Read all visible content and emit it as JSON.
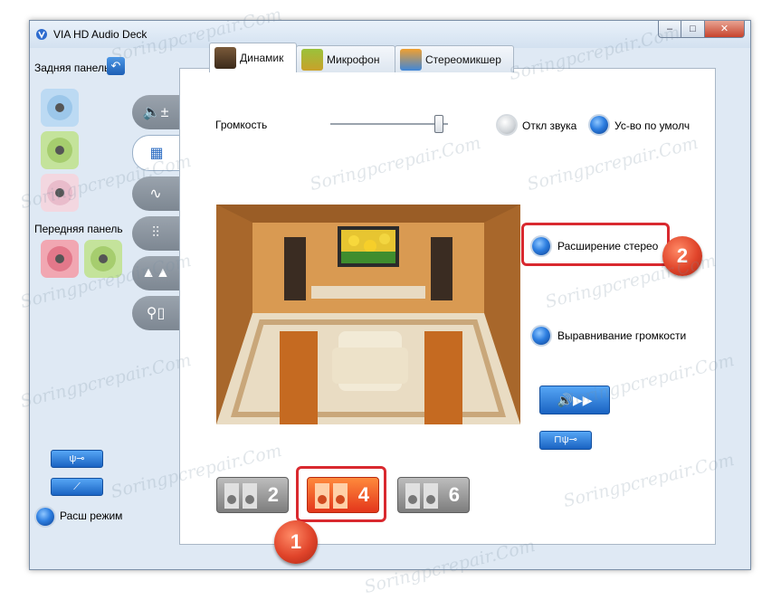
{
  "window": {
    "title": "VIA HD Audio Deck"
  },
  "left": {
    "back_panel_label": "Задняя панель",
    "front_panel_label": "Передняя панель",
    "mode_label": "Расш режим"
  },
  "tabs": [
    {
      "label": "Динамик",
      "active": true
    },
    {
      "label": "Микрофон",
      "active": false
    },
    {
      "label": "Стереомикшер",
      "active": false
    }
  ],
  "volume": {
    "label": "Громкость",
    "level_percent": 96
  },
  "mute": {
    "label": "Откл звука"
  },
  "default_device": {
    "label": "Ус-во по умолч"
  },
  "stereo_expansion": {
    "label": "Расширение стерео"
  },
  "loudness_eq": {
    "label": "Выравнивание громкости"
  },
  "speaker_config": [
    {
      "label": "2",
      "active": false
    },
    {
      "label": "4",
      "active": true
    },
    {
      "label": "6",
      "active": false
    }
  ],
  "badges": {
    "one": "1",
    "two": "2"
  },
  "watermark": "Soringpcrepair.Com",
  "colors": {
    "accent_blue": "#2d7ee0",
    "highlight_red": "#d9292f",
    "active_orange": "#ff6a2a"
  }
}
